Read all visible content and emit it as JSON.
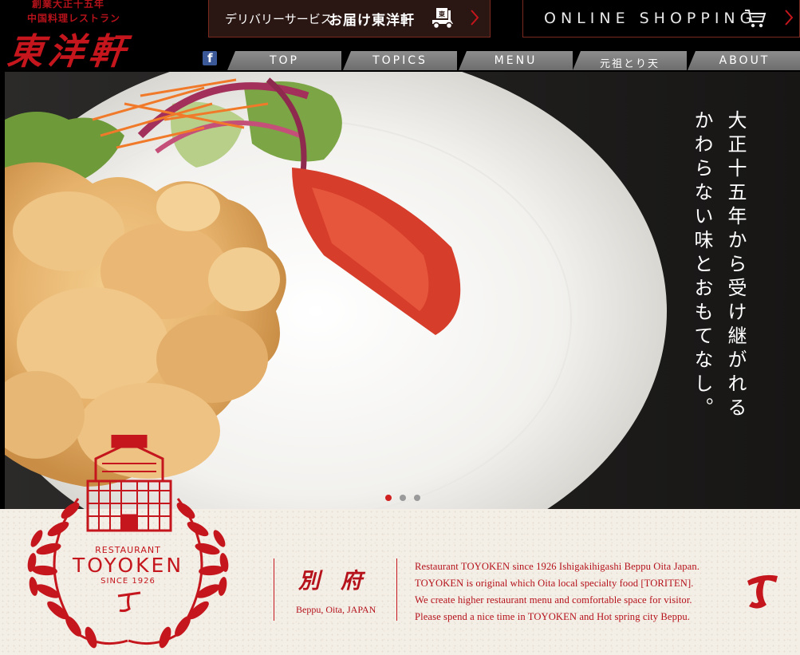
{
  "header": {
    "logo": {
      "tagline1": "創業大正十五年",
      "tagline2": "中国料理レストラン",
      "name": "東洋軒"
    },
    "delivery": {
      "label": "デリバリーサービス",
      "brand": "お届け東洋軒"
    },
    "online_shopping": {
      "label": "ONLINE SHOPPING"
    },
    "facebook": {
      "glyph": "f"
    }
  },
  "nav": {
    "tabs": [
      {
        "label": "TOP"
      },
      {
        "label": "TOPICS"
      },
      {
        "label": "MENU"
      },
      {
        "label": "元祖とり天"
      },
      {
        "label": "ABOUT"
      }
    ]
  },
  "hero": {
    "headline_col1": "大正十五年から受け継がれる",
    "headline_col2": "かわらない味とおもてなし。",
    "slider": {
      "total": 3,
      "active": 1
    }
  },
  "emblem": {
    "restaurant": "RESTAURANT",
    "name": "TOYOKEN",
    "since": "SINCE 1926"
  },
  "location": {
    "city_kanji": "別府",
    "city": "Beppu, Oita, JAPAN"
  },
  "intro": {
    "lines": [
      "Restaurant TOYOKEN since 1926 Ishigakihigashi Beppu Oita Japan.",
      "TOYOKEN is original which Oita local specialty food [TORITEN].",
      "We create higher restaurant menu and comfortable space for visitor.",
      "Please spend a nice time in TOYOKEN and Hot spring city Beppu."
    ]
  },
  "colors": {
    "brand_red": "#c4161c",
    "dot_active": "#d0201f",
    "dot_inactive": "#9a9a9a",
    "nav_gray": "#7a7a7a"
  },
  "icons": [
    "facebook-icon",
    "delivery-scooter-icon",
    "shopping-cart-icon",
    "chevron-right-icon",
    "t-monogram-icon"
  ]
}
